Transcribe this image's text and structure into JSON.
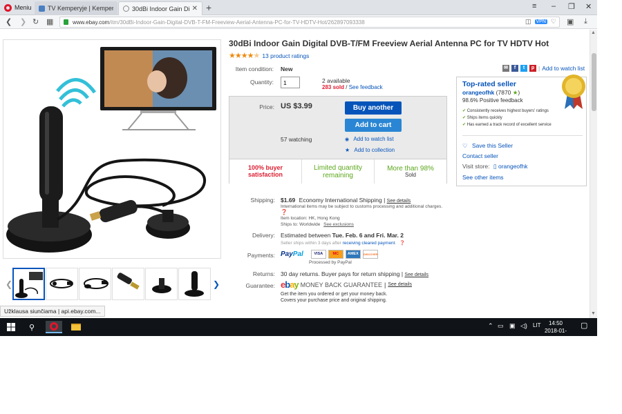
{
  "browser": {
    "menu_label": "Meniu",
    "tabs": [
      {
        "title": "TV Kemperyje | Kemperiu",
        "state": "inactive"
      },
      {
        "title": "30dBi Indoor Gain Digital",
        "state": "active"
      }
    ],
    "new_tab_icon": "plus-icon",
    "url_domain": "www.ebay.com",
    "url_path": "/itm/30dBi-Indoor-Gain-Digital-DVB-T-FM-Freeview-Aerial-Antenna-PC-for-TV-HDTV-Hot/262897093338",
    "vpn_badge": "VPN",
    "status_tooltip": "Užklausa siunčiama | api.ebay.com..."
  },
  "product": {
    "title": "30dBi Indoor Gain Digital DVB-T/FM Freeview Aerial Antenna PC for TV HDTV Hot",
    "rating": 4.5,
    "ratings_link": "13 product ratings",
    "share_link": "Add to watch list"
  },
  "details": {
    "condition_label": "Item condition:",
    "condition_value": "New",
    "quantity_label": "Quantity:",
    "quantity_value": "1",
    "available": "2 available",
    "sold_count": "283 sold",
    "sold_separator": "/",
    "feedback_link": "See feedback"
  },
  "purchase": {
    "price_label": "Price:",
    "price": "US $3.99",
    "buy_button": "Buy another",
    "cart_button": "Add to cart",
    "watching": "57 watching",
    "watch_link": "Add to watch list",
    "collection_link": "Add to collection",
    "stats": [
      {
        "line1": "100% buyer",
        "line2": "satisfaction",
        "color": "#dd1e31"
      },
      {
        "line1": "Limited quantity",
        "line2": "remaining",
        "color": "#5ba71b"
      },
      {
        "line1": "More than 98%",
        "line2": "Sold",
        "color": "#5ba71b"
      }
    ]
  },
  "seller": {
    "heading": "Top-rated seller",
    "name": "orangeofhk",
    "score": "(7870",
    "score_close": ")",
    "positive": "98.6% Positive feedback",
    "perks": [
      "Consistently receives highest buyers' ratings",
      "Ships items quickly",
      "Has earned a track record of excellent service"
    ],
    "save_link": "Save this Seller",
    "contact_link": "Contact seller",
    "visit_label": "Visit store:",
    "store_name": "orangeofhk",
    "other_items": "See other items"
  },
  "shipping": {
    "label": "Shipping:",
    "cost": "$1.69",
    "method": "Economy International Shipping",
    "separator": "|",
    "details_link": "See details",
    "note": "International items may be subject to customs processing and additional charges.",
    "location_label": "Item location:",
    "location": "HK, Hong Kong",
    "ships_to_label": "Ships to:",
    "ships_to": "Worldwide",
    "exclusions_link": "See exclusions"
  },
  "delivery": {
    "label": "Delivery:",
    "estimate_prefix": "Estimated between",
    "estimate_dates": "Tue. Feb. 6 and Fri. Mar. 2",
    "note_prefix": "Seller ships within 3 days after",
    "note_link": "receiving cleared payment",
    "note_suffix": "."
  },
  "payments": {
    "label": "Payments:",
    "paypal_pay": "Pay",
    "paypal_pal": "Pal",
    "cards": [
      "VISA",
      "MC",
      "AMEX",
      "DISCOVER"
    ],
    "processed": "Processed by PayPal"
  },
  "returns": {
    "label": "Returns:",
    "text": "30 day returns. Buyer pays for return shipping",
    "separator": "|",
    "details_link": "See details"
  },
  "guarantee": {
    "label": "Guarantee:",
    "ebay_letters": [
      "e",
      "b",
      "a",
      "y"
    ],
    "headline": "MONEY BACK GUARANTEE",
    "separator": "|",
    "details_link": "See details",
    "line1": "Get the item you ordered or get your money back.",
    "line2": "Covers your purchase price and original shipping."
  },
  "taskbar": {
    "language": "LIT",
    "time": "14:50",
    "date": "2018-01-18"
  },
  "colors": {
    "ebay_blue": "#0654ba",
    "ebay_red": "#e53238",
    "ebay_yellow": "#f5af02",
    "ebay_green": "#86b817",
    "sold_red": "#dd1e31"
  }
}
